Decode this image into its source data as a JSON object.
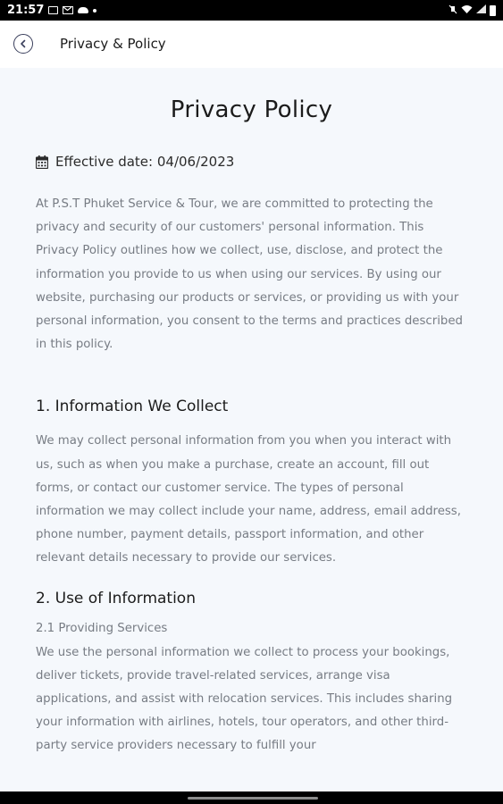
{
  "status_bar": {
    "time": "21:57"
  },
  "app_bar": {
    "title": "Privacy & Policy",
    "back_icon": "back-chevron-circle-icon"
  },
  "page": {
    "title": "Privacy Policy",
    "effective_icon": "calendar-icon",
    "effective_date": "Effective date: 04/06/2023",
    "intro": "At P.S.T Phuket Service & Tour, we are committed to protecting the privacy and security of our customers' personal information. This Privacy Policy outlines how we collect, use, disclose, and protect the information you provide to us when using our services. By using our website, purchasing our products or services, or providing us with your personal information, you consent to the terms and practices described in this policy.",
    "sections": [
      {
        "heading": "1. Information We Collect",
        "body": "We may collect personal information from you when you interact with us, such as when you make a purchase, create an account, fill out forms, or contact our customer service. The types of personal information we may collect include your name, address, email address, phone number, payment details, passport information, and other relevant details necessary to provide our services."
      },
      {
        "heading": "2. Use of Information",
        "subheading": "2.1 Providing Services",
        "body": "We use the personal information we collect to process your bookings, deliver tickets, provide travel-related services, arrange visa applications, and assist with relocation services. This includes sharing your information with airlines, hotels, tour operators, and other third-party service providers necessary to fulfill your"
      }
    ]
  },
  "colors": {
    "background": "#f5f8fc",
    "body_text": "#777c84",
    "heading_text": "#1b1b1b",
    "app_bar": "#ffffff"
  }
}
